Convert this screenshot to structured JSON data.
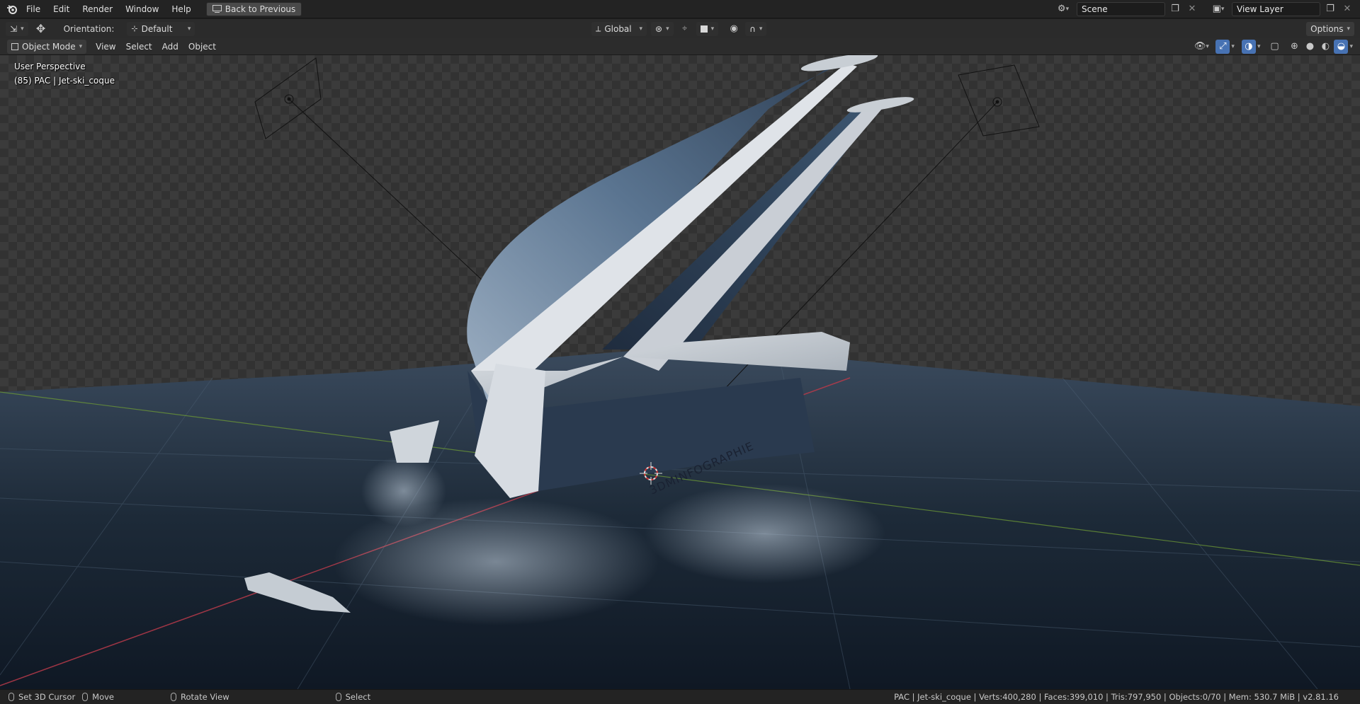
{
  "menu": {
    "items": [
      "File",
      "Edit",
      "Render",
      "Window",
      "Help"
    ],
    "back_button": "Back to Previous"
  },
  "workspace": {
    "scene_name": "Scene",
    "view_layer_name": "View Layer"
  },
  "toolbar": {
    "orientation_label": "Orientation:",
    "orientation_value": "Default",
    "transform_orientation": "Global",
    "options_label": "Options"
  },
  "header": {
    "mode": "Object Mode",
    "menus": [
      "View",
      "Select",
      "Add",
      "Object"
    ]
  },
  "viewport": {
    "perspective": "User Perspective",
    "active_object": "(85) PAC | Jet-ski_coque",
    "hull_text": "3DMINFOGRAPHIE"
  },
  "statusbar": {
    "left_items": [
      "Set 3D Cursor",
      "Move",
      "Rotate View",
      "Select"
    ],
    "stats": "PAC | Jet-ski_coque | Verts:400,280 | Faces:399,010 | Tris:797,950 | Objects:0/70 | Mem: 530.7 MiB | v2.81.16"
  },
  "colors": {
    "background": "#1d1d1d",
    "header": "#2b2b2b",
    "accent_blue": "#4772b3",
    "axis_red": "#b83a4a",
    "axis_green": "#6e9a35"
  },
  "icons": {
    "app": "blender-logo-icon",
    "gizmo": "move-gizmo-icon",
    "camera": "camera-icon"
  }
}
